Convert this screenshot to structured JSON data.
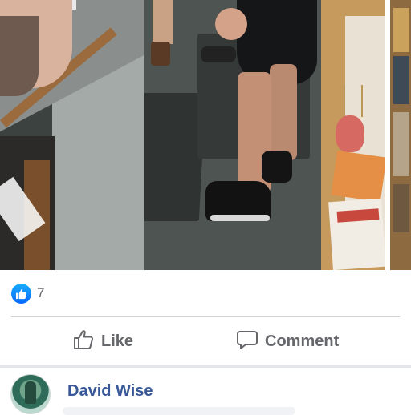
{
  "reactions": {
    "count": "7",
    "icon": "thumbs-up-icon"
  },
  "actions": {
    "like_label": "Like",
    "comment_label": "Comment"
  },
  "comment": {
    "author": "David Wise"
  },
  "colors": {
    "like_blue": "#0866ff",
    "action_gray": "#65676b",
    "author_blue": "#385898",
    "divider": "#ced0d4"
  }
}
